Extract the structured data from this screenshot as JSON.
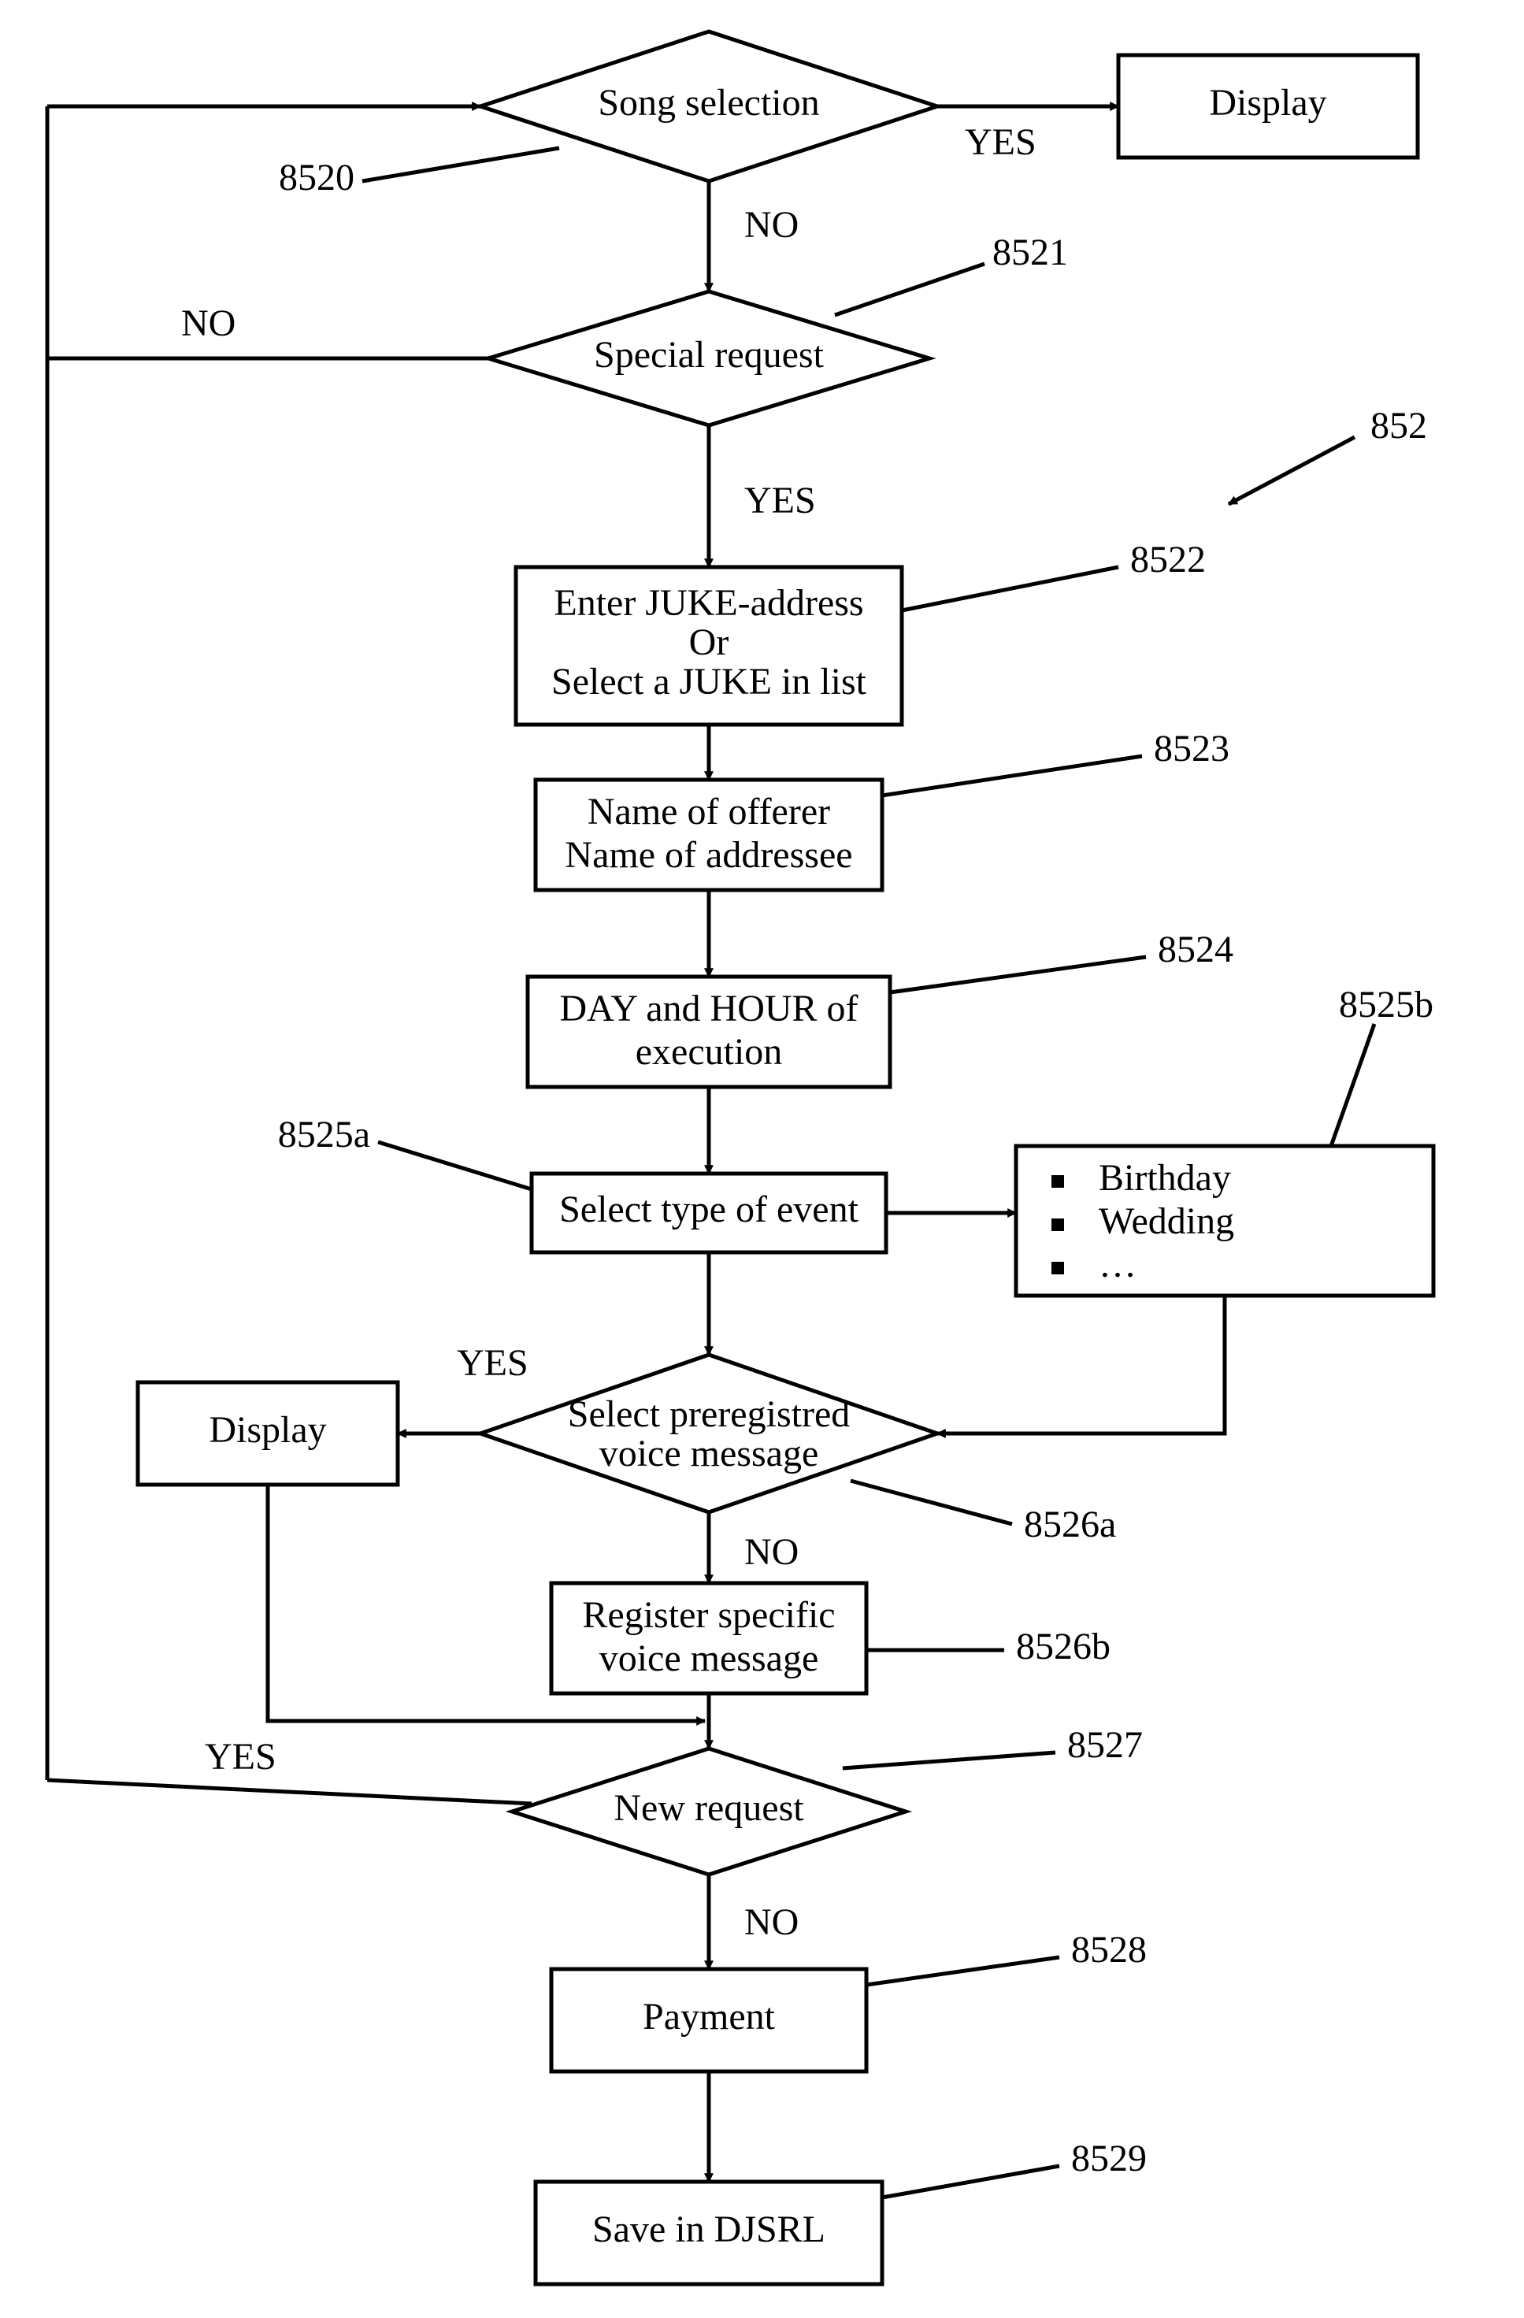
{
  "nodes": {
    "song_selection": "Song selection",
    "display_top": "Display",
    "special_request": "Special request",
    "enter_juke_l1": "Enter JUKE-address",
    "enter_juke_l2": "Or",
    "enter_juke_l3": "Select a JUKE in list",
    "offerer_l1": "Name of offerer",
    "offerer_l2": "Name of addressee",
    "dayhour_l1": "DAY and HOUR of",
    "dayhour_l2": "execution",
    "select_event": "Select type of event",
    "event_list_1": "Birthday",
    "event_list_2": "Wedding",
    "event_list_3": "…",
    "select_prereg_l1": "Select preregistred",
    "select_prereg_l2": "voice message",
    "display_left": "Display",
    "register_l1": "Register specific",
    "register_l2": "voice message",
    "new_request": "New request",
    "payment": "Payment",
    "save": "Save in DJSRL"
  },
  "edges": {
    "yes": "YES",
    "no": "NO"
  },
  "refs": {
    "r8520": "8520",
    "r8521": "8521",
    "r852": "852",
    "r8522": "8522",
    "r8523": "8523",
    "r8524": "8524",
    "r8525a": "8525a",
    "r8525b": "8525b",
    "r8526a": "8526a",
    "r8526b": "8526b",
    "r8527": "8527",
    "r8528": "8528",
    "r8529": "8529"
  }
}
